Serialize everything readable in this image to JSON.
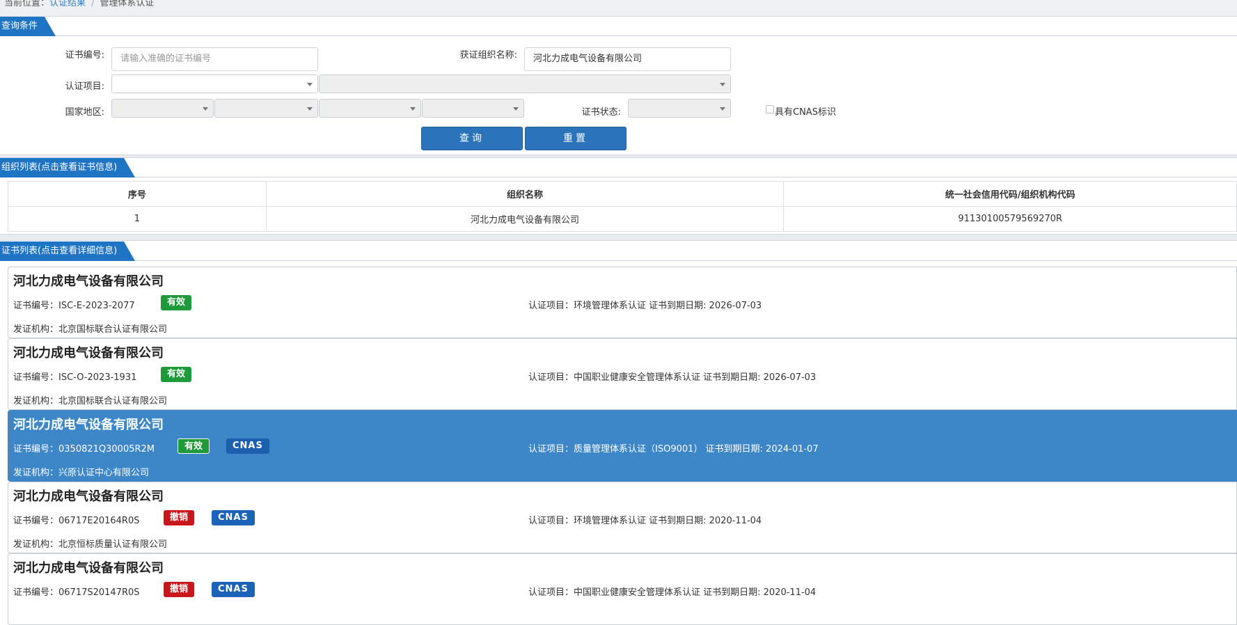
{
  "breadcrumb": {
    "prefix": "当前位置：",
    "link": "认证结果",
    "current": "管理体系认证"
  },
  "query": {
    "section_title": "查询条件",
    "cert_no_label": "证书编号:",
    "cert_no_placeholder": "请输入准确的证书编号",
    "org_name_label": "获证组织名称:",
    "org_name_value": "河北力成电气设备有限公司",
    "project_label": "认证项目:",
    "region_label": "国家地区:",
    "status_label": "证书状态:",
    "cnas_label": "具有CNAS标识",
    "search_button": "查询",
    "reset_button": "重置"
  },
  "org_list": {
    "section_title": "组织列表(点击查看证书信息)",
    "columns": [
      "序号",
      "组织名称",
      "统一社会信用代码/组织机构代码"
    ],
    "rows": [
      [
        "1",
        "河北力成电气设备有限公司",
        "91130100579569270R"
      ]
    ]
  },
  "cert_list": {
    "section_title": "证书列表(点击查看详细信息)",
    "items": [
      {
        "org": "河北力成电气设备有限公司",
        "cert_no": "证书编号：ISC-E-2023-2077",
        "status": "有效",
        "cnas": "",
        "project": "认证项目：环境管理体系认证    证书到期日期: 2026-07-03",
        "issuer": "发证机构：北京国标联合认证有限公司"
      },
      {
        "org": "河北力成电气设备有限公司",
        "cert_no": "证书编号：ISC-O-2023-1931",
        "status": "有效",
        "cnas": "",
        "project": "认证项目：中国职业健康安全管理体系认证    证书到期日期: 2026-07-03",
        "issuer": "发证机构：北京国标联合认证有限公司"
      },
      {
        "org": "河北力成电气设备有限公司",
        "cert_no": "证书编号：0350821Q30005R2M",
        "status": "有效",
        "cnas": "CNAS",
        "project": "认证项目：质量管理体系认证（ISO9001）    证书到期日期: 2024-01-07",
        "issuer": "发证机构：兴原认证中心有限公司"
      },
      {
        "org": "河北力成电气设备有限公司",
        "cert_no": "证书编号：06717E20164R0S",
        "status": "撤销",
        "cnas": "CNAS",
        "project": "认证项目：环境管理体系认证    证书到期日期: 2020-11-04",
        "issuer": "发证机构：北京恒标质量认证有限公司"
      },
      {
        "org": "河北力成电气设备有限公司",
        "cert_no": "证书编号：06717S20147R0S",
        "status": "撤销",
        "cnas": "CNAS",
        "project": "认证项目：中国职业健康安全管理体系认证    证书到期日期: 2020-11-04",
        "issuer": ""
      }
    ]
  },
  "colors": {
    "primary": "#1f75c4",
    "button": "#2b73ba",
    "active_row": "#3d87c9",
    "valid": "#1f9a3a",
    "revoked": "#c9151b",
    "cnas": "#1b62b8"
  }
}
